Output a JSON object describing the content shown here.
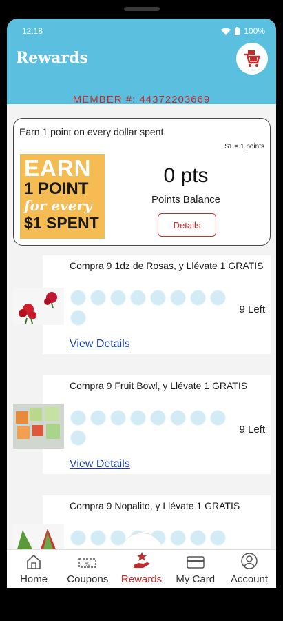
{
  "status": {
    "time": "12:18",
    "battery": "100%"
  },
  "header": {
    "title": "Rewards"
  },
  "member": {
    "label": "MEMBER #: 44372203669"
  },
  "points_card": {
    "earn_text": "Earn 1 point on every dollar spent",
    "ratio": "$1 = 1 points",
    "banner_line1": "EARN",
    "banner_line2": "1 POINT",
    "banner_line3": "for every",
    "banner_line4": "$1 SPENT",
    "points_value": "0 pts",
    "points_label": "Points Balance",
    "details_label": "Details"
  },
  "rewards": [
    {
      "title": "Compra 9 1dz de Rosas, y Llévate 1 GRATIS",
      "left": "9 Left",
      "view_label": "View Details",
      "stamps": 9
    },
    {
      "title": "Compra 9 Fruit Bowl, y Llévate 1 GRATIS",
      "left": "9 Left",
      "view_label": "View Details",
      "stamps": 9
    },
    {
      "title": "Compra 9 Nopalito, y Llévate 1 GRATIS",
      "left": "",
      "view_label": "",
      "stamps": 9
    }
  ],
  "nav": {
    "home": "Home",
    "coupons": "Coupons",
    "rewards": "Rewards",
    "mycard": "My Card",
    "account": "Account"
  },
  "colors": {
    "accent": "#c42b2b",
    "header": "#5bbfe0",
    "link": "#1d3fa3",
    "stamp": "#d3ebf5",
    "banner": "#f4bc52"
  }
}
